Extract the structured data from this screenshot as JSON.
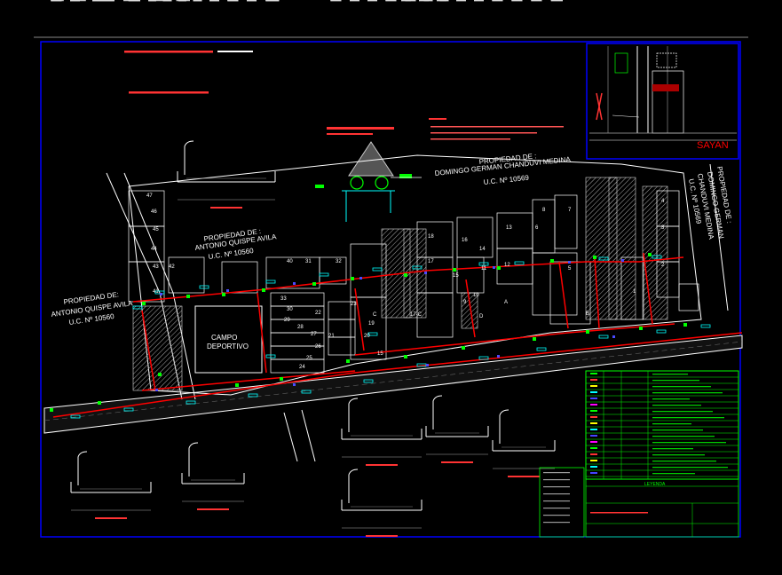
{
  "sheet": {
    "colors": {
      "background": "#000000",
      "frame": "#0000ff",
      "table": "#00ff00",
      "network": "#ff0000",
      "cyan": "#00ffff",
      "yellow": "#ffff00",
      "white": "#ffffff"
    }
  },
  "locator": {
    "city_label": "SAYAN"
  },
  "properties": {
    "owner1": [
      "PROPIEDAD DE :",
      "DOMINGO GERMAN CHANDUVI MEDINA",
      "U.C. Nº 10569"
    ],
    "owner2": [
      "PROPIEDAD DE :",
      "ANTONIO QUISPE AVILA",
      "U.C. Nº 10560"
    ],
    "owner3": [
      "PROPIEDAD DE:",
      "ANTONIO QUISPE AVILA",
      "U.C. Nº 10560"
    ],
    "owner4": [
      "PROPIEDAD DE :",
      "DOMINGO GERMAN",
      "CHANDUVI MEDINA",
      "U.C. Nº 10569"
    ]
  },
  "field_label": [
    "CAMPO",
    "DEPORTIVO"
  ],
  "lot_numbers": [
    "47",
    "46",
    "45",
    "44",
    "43",
    "42",
    "41",
    "40",
    "31",
    "32",
    "33",
    "30",
    "29",
    "28",
    "27",
    "26",
    "25",
    "24",
    "23",
    "22",
    "21",
    "20",
    "19",
    "18",
    "17",
    "16",
    "15",
    "14",
    "13",
    "12",
    "11",
    "10",
    "9",
    "8",
    "7",
    "6",
    "5",
    "4",
    "3",
    "2",
    "1",
    "A",
    "B",
    "C",
    "D",
    "17-C",
    "15"
  ],
  "legend_title": "LEYENDA"
}
